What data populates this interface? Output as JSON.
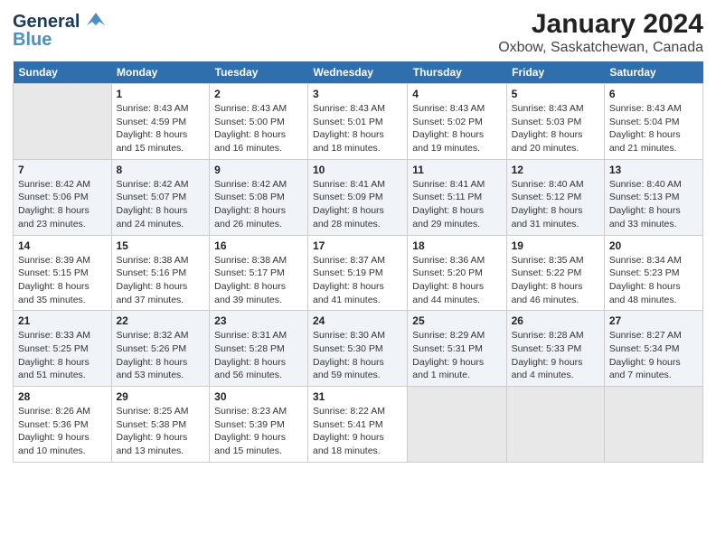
{
  "header": {
    "logo_line1": "General",
    "logo_line2": "Blue",
    "title": "January 2024",
    "subtitle": "Oxbow, Saskatchewan, Canada"
  },
  "days_of_week": [
    "Sunday",
    "Monday",
    "Tuesday",
    "Wednesday",
    "Thursday",
    "Friday",
    "Saturday"
  ],
  "weeks": [
    [
      {
        "date": "",
        "info": ""
      },
      {
        "date": "1",
        "info": "Sunrise: 8:43 AM\nSunset: 4:59 PM\nDaylight: 8 hours\nand 15 minutes."
      },
      {
        "date": "2",
        "info": "Sunrise: 8:43 AM\nSunset: 5:00 PM\nDaylight: 8 hours\nand 16 minutes."
      },
      {
        "date": "3",
        "info": "Sunrise: 8:43 AM\nSunset: 5:01 PM\nDaylight: 8 hours\nand 18 minutes."
      },
      {
        "date": "4",
        "info": "Sunrise: 8:43 AM\nSunset: 5:02 PM\nDaylight: 8 hours\nand 19 minutes."
      },
      {
        "date": "5",
        "info": "Sunrise: 8:43 AM\nSunset: 5:03 PM\nDaylight: 8 hours\nand 20 minutes."
      },
      {
        "date": "6",
        "info": "Sunrise: 8:43 AM\nSunset: 5:04 PM\nDaylight: 8 hours\nand 21 minutes."
      }
    ],
    [
      {
        "date": "7",
        "info": "Sunrise: 8:42 AM\nSunset: 5:06 PM\nDaylight: 8 hours\nand 23 minutes."
      },
      {
        "date": "8",
        "info": "Sunrise: 8:42 AM\nSunset: 5:07 PM\nDaylight: 8 hours\nand 24 minutes."
      },
      {
        "date": "9",
        "info": "Sunrise: 8:42 AM\nSunset: 5:08 PM\nDaylight: 8 hours\nand 26 minutes."
      },
      {
        "date": "10",
        "info": "Sunrise: 8:41 AM\nSunset: 5:09 PM\nDaylight: 8 hours\nand 28 minutes."
      },
      {
        "date": "11",
        "info": "Sunrise: 8:41 AM\nSunset: 5:11 PM\nDaylight: 8 hours\nand 29 minutes."
      },
      {
        "date": "12",
        "info": "Sunrise: 8:40 AM\nSunset: 5:12 PM\nDaylight: 8 hours\nand 31 minutes."
      },
      {
        "date": "13",
        "info": "Sunrise: 8:40 AM\nSunset: 5:13 PM\nDaylight: 8 hours\nand 33 minutes."
      }
    ],
    [
      {
        "date": "14",
        "info": "Sunrise: 8:39 AM\nSunset: 5:15 PM\nDaylight: 8 hours\nand 35 minutes."
      },
      {
        "date": "15",
        "info": "Sunrise: 8:38 AM\nSunset: 5:16 PM\nDaylight: 8 hours\nand 37 minutes."
      },
      {
        "date": "16",
        "info": "Sunrise: 8:38 AM\nSunset: 5:17 PM\nDaylight: 8 hours\nand 39 minutes."
      },
      {
        "date": "17",
        "info": "Sunrise: 8:37 AM\nSunset: 5:19 PM\nDaylight: 8 hours\nand 41 minutes."
      },
      {
        "date": "18",
        "info": "Sunrise: 8:36 AM\nSunset: 5:20 PM\nDaylight: 8 hours\nand 44 minutes."
      },
      {
        "date": "19",
        "info": "Sunrise: 8:35 AM\nSunset: 5:22 PM\nDaylight: 8 hours\nand 46 minutes."
      },
      {
        "date": "20",
        "info": "Sunrise: 8:34 AM\nSunset: 5:23 PM\nDaylight: 8 hours\nand 48 minutes."
      }
    ],
    [
      {
        "date": "21",
        "info": "Sunrise: 8:33 AM\nSunset: 5:25 PM\nDaylight: 8 hours\nand 51 minutes."
      },
      {
        "date": "22",
        "info": "Sunrise: 8:32 AM\nSunset: 5:26 PM\nDaylight: 8 hours\nand 53 minutes."
      },
      {
        "date": "23",
        "info": "Sunrise: 8:31 AM\nSunset: 5:28 PM\nDaylight: 8 hours\nand 56 minutes."
      },
      {
        "date": "24",
        "info": "Sunrise: 8:30 AM\nSunset: 5:30 PM\nDaylight: 8 hours\nand 59 minutes."
      },
      {
        "date": "25",
        "info": "Sunrise: 8:29 AM\nSunset: 5:31 PM\nDaylight: 9 hours\nand 1 minute."
      },
      {
        "date": "26",
        "info": "Sunrise: 8:28 AM\nSunset: 5:33 PM\nDaylight: 9 hours\nand 4 minutes."
      },
      {
        "date": "27",
        "info": "Sunrise: 8:27 AM\nSunset: 5:34 PM\nDaylight: 9 hours\nand 7 minutes."
      }
    ],
    [
      {
        "date": "28",
        "info": "Sunrise: 8:26 AM\nSunset: 5:36 PM\nDaylight: 9 hours\nand 10 minutes."
      },
      {
        "date": "29",
        "info": "Sunrise: 8:25 AM\nSunset: 5:38 PM\nDaylight: 9 hours\nand 13 minutes."
      },
      {
        "date": "30",
        "info": "Sunrise: 8:23 AM\nSunset: 5:39 PM\nDaylight: 9 hours\nand 15 minutes."
      },
      {
        "date": "31",
        "info": "Sunrise: 8:22 AM\nSunset: 5:41 PM\nDaylight: 9 hours\nand 18 minutes."
      },
      {
        "date": "",
        "info": ""
      },
      {
        "date": "",
        "info": ""
      },
      {
        "date": "",
        "info": ""
      }
    ]
  ]
}
